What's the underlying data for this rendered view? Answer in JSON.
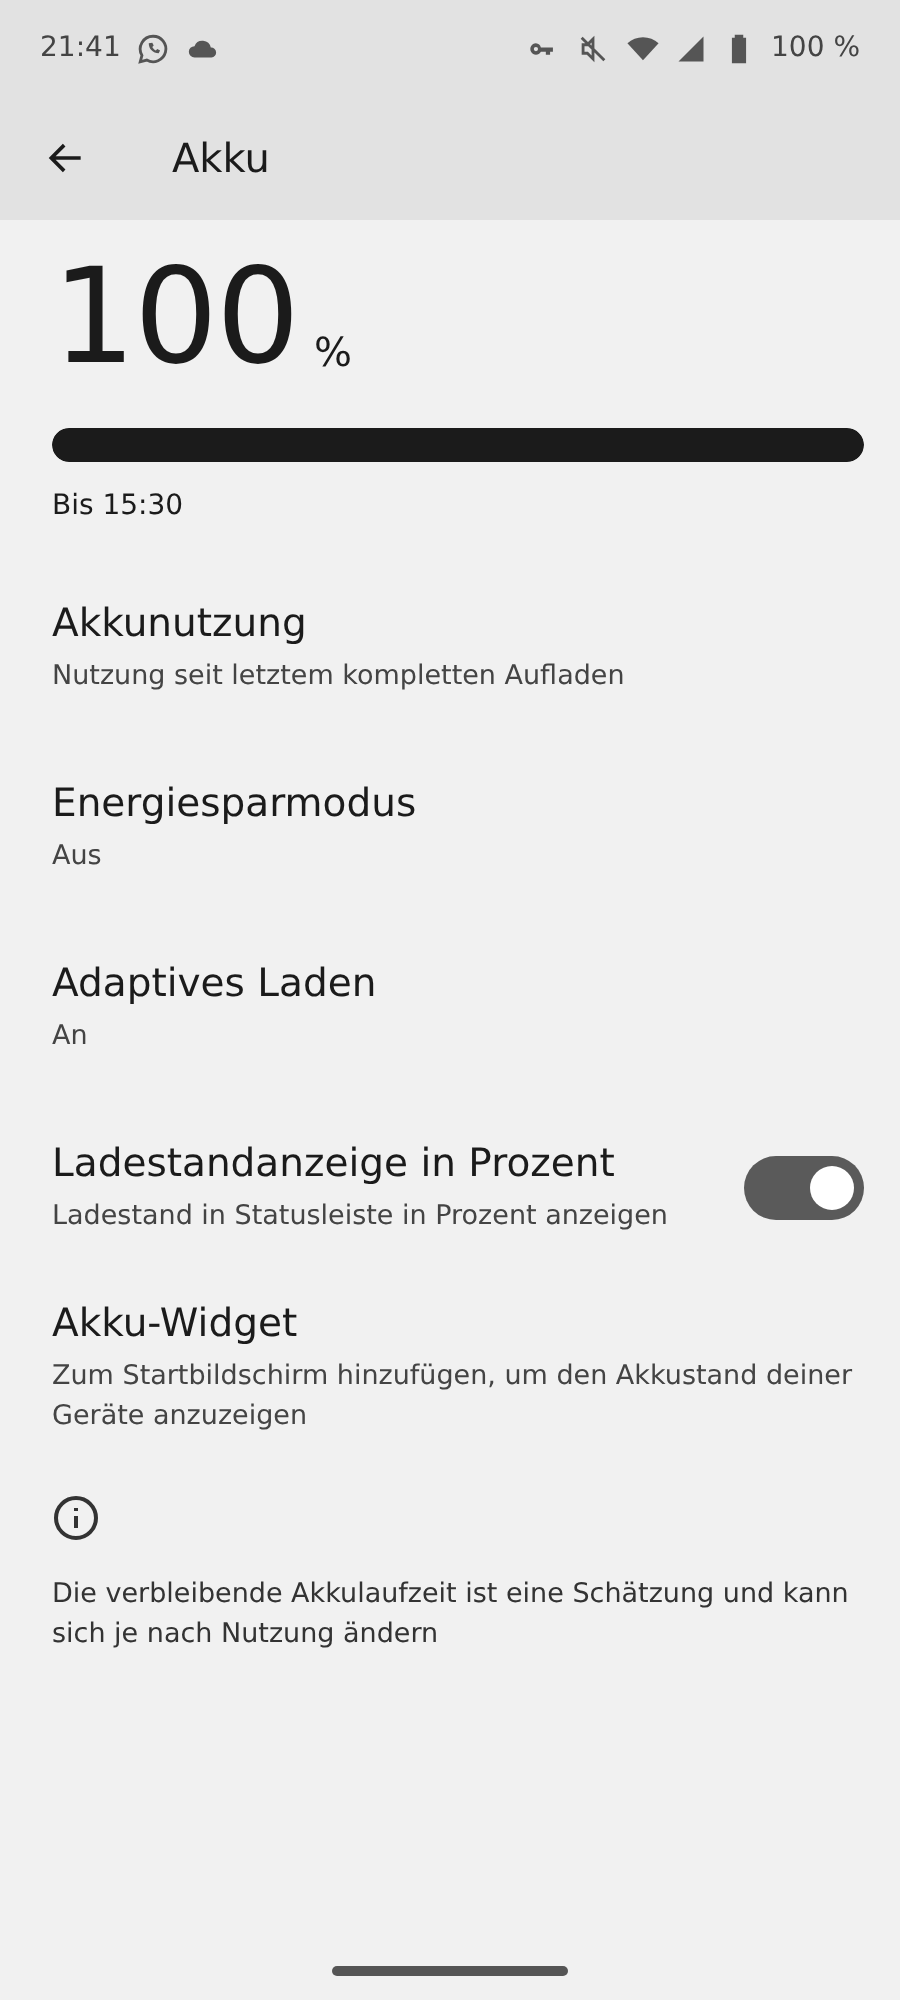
{
  "status_bar": {
    "time": "21:41",
    "battery_text": "100 %"
  },
  "toolbar": {
    "title": "Akku"
  },
  "battery": {
    "value": "100",
    "unit": "%",
    "level": 1,
    "estimate": "Bis 15:30"
  },
  "items": [
    {
      "kind": "text",
      "title": "Akkunutzung",
      "subtitle": "Nutzung seit letztem kompletten Aufladen"
    },
    {
      "kind": "text",
      "title": "Energiesparmodus",
      "subtitle": "Aus"
    },
    {
      "kind": "text",
      "title": "Adaptives Laden",
      "subtitle": "An"
    },
    {
      "kind": "toggle",
      "title": "Ladestandanzeige in Prozent",
      "subtitle": "Ladestand in Statusleiste in Prozent anzeigen",
      "on": true
    },
    {
      "kind": "text",
      "title": "Akku-Widget",
      "subtitle": "Zum Startbildschirm hinzufügen, um den Akkustand deiner Geräte anzuzeigen"
    }
  ],
  "footer": {
    "text": "Die verbleibende Akkulaufzeit ist eine Schätzung und kann sich je nach Nutzung ändern"
  }
}
